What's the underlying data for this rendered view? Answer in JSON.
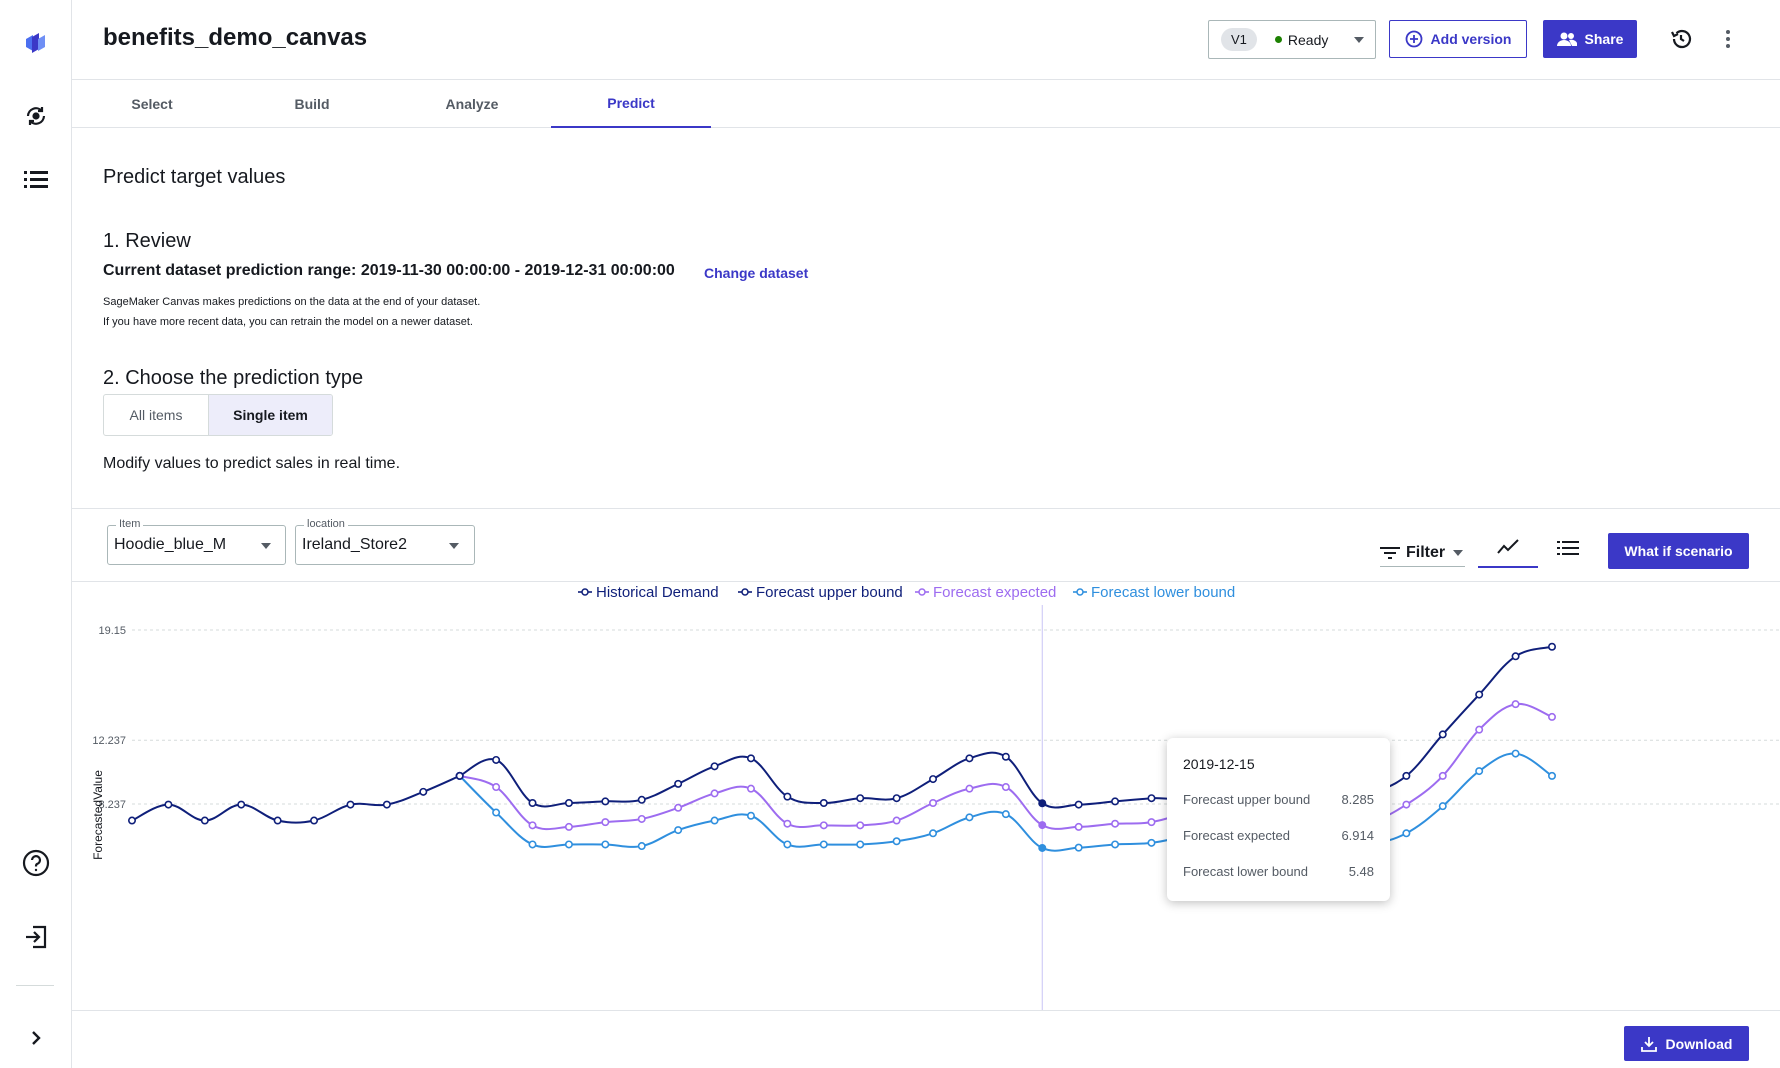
{
  "header": {
    "title": "benefits_demo_canvas",
    "version_badge": "V1",
    "status": "Ready",
    "add_version_label": "Add version",
    "share_label": "Share"
  },
  "tabs": [
    {
      "label": "Select",
      "active": false
    },
    {
      "label": "Build",
      "active": false
    },
    {
      "label": "Analyze",
      "active": false
    },
    {
      "label": "Predict",
      "active": true
    }
  ],
  "main": {
    "title": "Predict target values",
    "review_heading": "1. Review",
    "range_text": "Current dataset prediction range: 2019-11-30 00:00:00 - 2019-12-31 00:00:00",
    "change_dataset": "Change dataset",
    "note_line1": "SageMaker Canvas makes predictions on the data at the end of your dataset.",
    "note_line2": "If you have more recent data, you can retrain the model on a newer dataset.",
    "type_heading": "2. Choose the prediction type",
    "segments": [
      "All items",
      "Single item"
    ],
    "selected_segment": "Single item",
    "modify_text": "Modify values to predict sales in real time."
  },
  "controls": {
    "item_label": "Item",
    "item_value": "Hoodie_blue_M",
    "location_label": "location",
    "location_value": "Ireland_Store2",
    "filter_label": "Filter",
    "what_if_label": "What if scenario",
    "download_label": "Download"
  },
  "tooltip": {
    "date": "2019-12-15",
    "rows": [
      {
        "label": "Forecast upper bound",
        "value": "8.285"
      },
      {
        "label": "Forecast expected",
        "value": "6.914"
      },
      {
        "label": "Forecast lower bound",
        "value": "5.48"
      }
    ]
  },
  "colors": {
    "accent": "#3b38c7",
    "historical": "#0f1f7a",
    "upper": "#0f1f7a",
    "expected": "#9d6cf0",
    "lower": "#2f8fde",
    "status_ready": "#1d8102"
  },
  "icons": {
    "rail": [
      "canvas-logo-icon",
      "models-icon",
      "datasets-icon",
      "help-icon",
      "sign-out-icon",
      "expand-icon"
    ],
    "header": [
      "history-icon",
      "more-options-icon"
    ]
  },
  "chart_data": {
    "type": "line",
    "ylabel": "ForecastedValue",
    "yticks": [
      8.237,
      12.237,
      19.15
    ],
    "ylim": [
      4.8,
      19.15
    ],
    "legend": "top",
    "grid": true,
    "x_index_range": [
      0,
      39
    ],
    "series": [
      {
        "name": "Historical Demand",
        "color": "#0f1f7a",
        "x": [
          0,
          1,
          2,
          3,
          4,
          5,
          6,
          7,
          8,
          9
        ],
        "values": [
          7.2,
          8.2,
          7.2,
          8.2,
          7.2,
          7.2,
          8.2,
          8.2,
          9.0,
          10.0
        ]
      },
      {
        "name": "Forecast upper bound",
        "color": "#0f1f7a",
        "x": [
          9,
          10,
          11,
          12,
          13,
          14,
          15,
          16,
          17,
          18,
          19,
          20,
          21,
          22,
          23,
          24,
          25,
          26,
          27,
          28,
          29,
          30,
          31,
          32,
          33,
          34,
          35,
          36,
          37,
          38,
          39
        ],
        "values": [
          10.0,
          11.0,
          8.3,
          8.3,
          8.4,
          8.5,
          9.5,
          10.6,
          11.1,
          8.7,
          8.3,
          8.6,
          8.6,
          9.8,
          11.1,
          11.2,
          8.285,
          8.2,
          8.4,
          8.6,
          8.8,
          11.1,
          11.2,
          8.1,
          8.3,
          8.9,
          10.0,
          12.6,
          15.1,
          17.5,
          18.1
        ]
      },
      {
        "name": "Forecast expected",
        "color": "#9d6cf0",
        "x": [
          9,
          10,
          11,
          12,
          13,
          14,
          15,
          16,
          17,
          18,
          19,
          20,
          21,
          22,
          23,
          24,
          25,
          26,
          27,
          28,
          29,
          30,
          31,
          32,
          33,
          34,
          35,
          36,
          37,
          38,
          39
        ],
        "values": [
          10.0,
          9.3,
          6.9,
          6.8,
          7.1,
          7.3,
          8.0,
          8.9,
          9.2,
          7.0,
          6.9,
          6.9,
          7.2,
          8.3,
          9.2,
          9.3,
          6.914,
          6.8,
          7.0,
          7.1,
          7.8,
          9.1,
          9.1,
          6.8,
          7.0,
          7.1,
          8.2,
          10.0,
          12.9,
          14.5,
          13.7
        ]
      },
      {
        "name": "Forecast lower bound",
        "color": "#2f8fde",
        "x": [
          9,
          10,
          11,
          12,
          13,
          14,
          15,
          16,
          17,
          18,
          19,
          20,
          21,
          22,
          23,
          24,
          25,
          26,
          27,
          28,
          29,
          30,
          31,
          32,
          33,
          34,
          35,
          36,
          37,
          38,
          39
        ],
        "values": [
          10.0,
          7.7,
          5.7,
          5.7,
          5.7,
          5.6,
          6.6,
          7.2,
          7.5,
          5.7,
          5.7,
          5.7,
          5.9,
          6.4,
          7.4,
          7.6,
          5.48,
          5.5,
          5.7,
          5.8,
          6.3,
          7.2,
          7.3,
          5.6,
          5.6,
          5.7,
          6.4,
          8.1,
          10.3,
          11.4,
          10.0
        ]
      }
    ],
    "hover_index": 25
  }
}
